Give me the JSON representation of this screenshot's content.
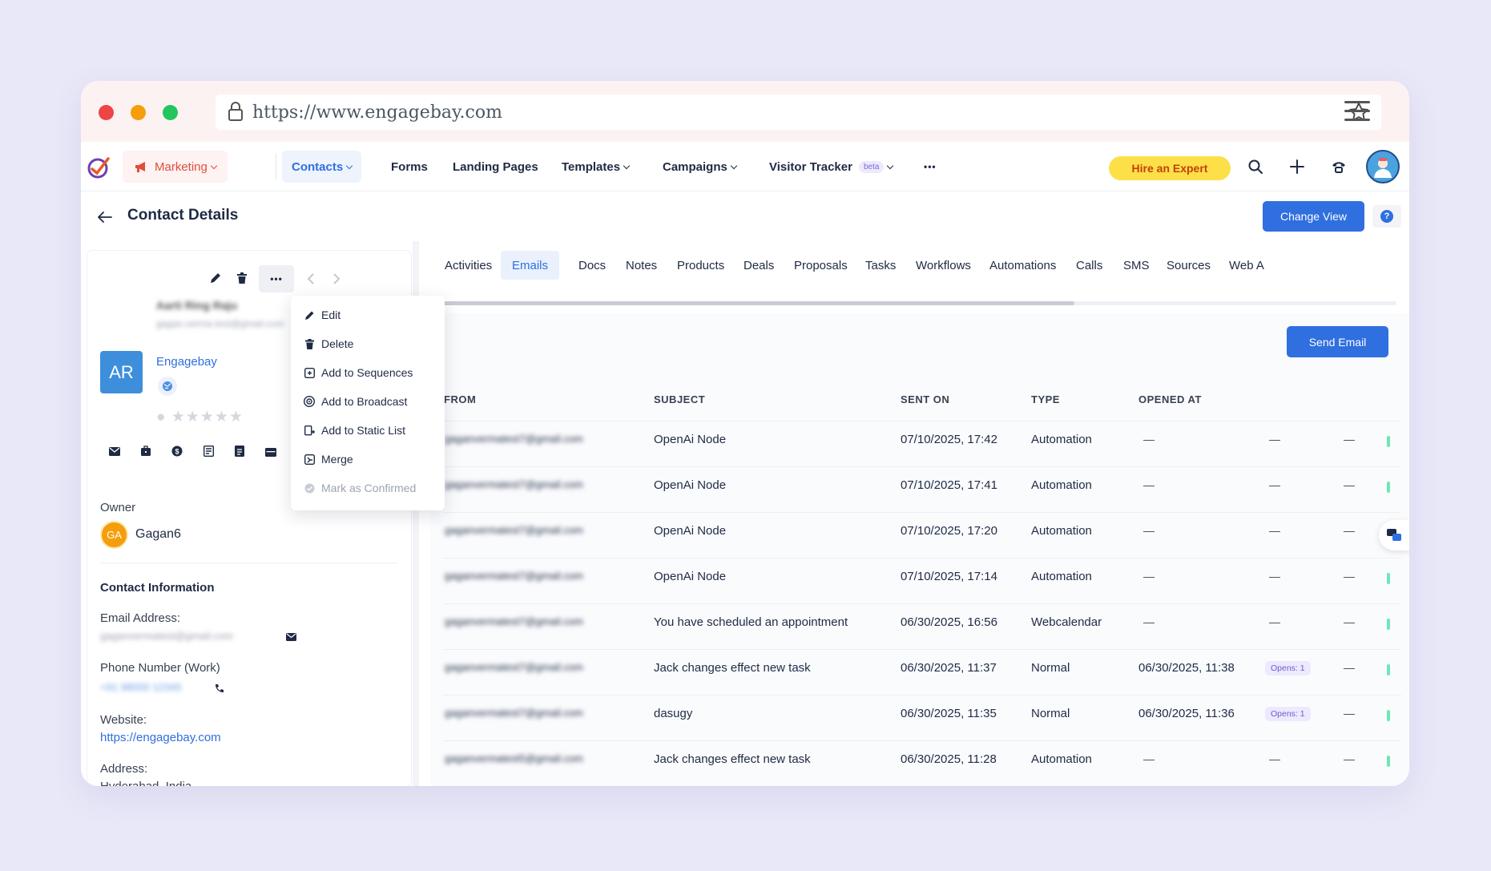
{
  "browser": {
    "url": "https://www.engagebay.com"
  },
  "nav": {
    "marketing": "Marketing",
    "items": [
      "Contacts",
      "Forms",
      "Landing Pages",
      "Templates",
      "Campaigns",
      "Visitor Tracker"
    ],
    "beta": "beta",
    "more": "•••",
    "hire": "Hire an Expert",
    "avatar_color": "#4aa3df"
  },
  "page": {
    "title": "Contact Details",
    "change_view": "Change View",
    "help": "?"
  },
  "contact": {
    "initials": "AR",
    "name_blurred": "Aarti Ring Raju",
    "email_blurred": "gagan.verma.test@gmail.com",
    "company": "Engagebay",
    "owner_label": "Owner",
    "owner_initials": "GA",
    "owner_name": "Gagan6",
    "info_title": "Contact Information",
    "email_label": "Email Address:",
    "email_value_blurred": "gaganvermatest@gmail.com",
    "phone_label": "Phone Number (Work)",
    "phone_value_blurred": "+91 98000 12345",
    "website_label": "Website:",
    "website_value": "https://engagebay.com",
    "address_label": "Address:",
    "address_value": "Hyderabad, India"
  },
  "menu": {
    "items": [
      "Edit",
      "Delete",
      "Add to Sequences",
      "Add to Broadcast",
      "Add to Static List",
      "Merge",
      "Mark as Confirmed"
    ]
  },
  "tabs": [
    "Activities",
    "Emails",
    "Docs",
    "Notes",
    "Products",
    "Deals",
    "Proposals",
    "Tasks",
    "Workflows",
    "Automations",
    "Calls",
    "SMS",
    "Sources",
    "Web A"
  ],
  "active_tab": "Emails",
  "send_email": "Send Email",
  "table": {
    "headers": [
      "FROM",
      "SUBJECT",
      "SENT ON",
      "TYPE",
      "OPENED AT"
    ],
    "rows": [
      {
        "from": "gaganvermatest7@gmail.com",
        "subject": "OpenAi Node",
        "sent": "07/10/2025, 17:42",
        "type": "Automation",
        "opened": "",
        "opens": ""
      },
      {
        "from": "gaganvermatest7@gmail.com",
        "subject": "OpenAi Node",
        "sent": "07/10/2025, 17:41",
        "type": "Automation",
        "opened": "",
        "opens": ""
      },
      {
        "from": "gaganvermatest7@gmail.com",
        "subject": "OpenAi Node",
        "sent": "07/10/2025, 17:20",
        "type": "Automation",
        "opened": "",
        "opens": ""
      },
      {
        "from": "gaganvermatest7@gmail.com",
        "subject": "OpenAi Node",
        "sent": "07/10/2025, 17:14",
        "type": "Automation",
        "opened": "",
        "opens": ""
      },
      {
        "from": "gaganvermatest7@gmail.com",
        "subject": "You have scheduled an appointment",
        "sent": "06/30/2025, 16:56",
        "type": "Webcalendar",
        "opened": "",
        "opens": ""
      },
      {
        "from": "gaganvermatest7@gmail.com",
        "subject": "Jack changes effect new task",
        "sent": "06/30/2025, 11:37",
        "type": "Normal",
        "opened": "06/30/2025, 11:38",
        "opens": "Opens: 1"
      },
      {
        "from": "gaganvermatest7@gmail.com",
        "subject": "dasugy",
        "sent": "06/30/2025, 11:35",
        "type": "Normal",
        "opened": "06/30/2025, 11:36",
        "opens": "Opens: 1"
      },
      {
        "from": "gaganvermatest5@gmail.com",
        "subject": "Jack changes effect new task",
        "sent": "06/30/2025, 11:28",
        "type": "Automation",
        "opened": "",
        "opens": ""
      }
    ]
  }
}
